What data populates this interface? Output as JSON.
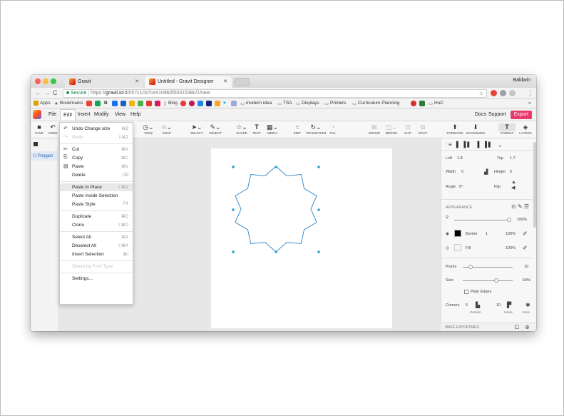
{
  "browser": {
    "tabs": [
      {
        "title": "Gravit"
      },
      {
        "title": "Untitled - Gravit Designer"
      }
    ],
    "profile": "Baldwin",
    "address": {
      "secure_label": "Secure",
      "protocol": "https://",
      "host": "gravit.io",
      "path": "/d/#57c1cb7ce4109b0f0031538c/1/new"
    },
    "bookmarks": [
      "Apps",
      "Bookmarks",
      "Blog",
      "modern idea",
      "TSA",
      "Displays",
      "Printers",
      "Curriculum Planning",
      "HoC"
    ],
    "bookmarks_more": "»"
  },
  "menubar": {
    "items": [
      "File",
      "Edit",
      "Insert",
      "Modify",
      "View",
      "Help"
    ],
    "active": "Edit",
    "docs": "Docs",
    "support": "Support",
    "export": "Export"
  },
  "toolbar": {
    "left": [
      "SAVE",
      "UNDO"
    ],
    "right_of_menu": [
      "VIEW",
      "SNAP",
      "SELECT",
      "OBJECT",
      "SHAPE",
      "TEXT",
      "MEDIA",
      "EDIT",
      "TRANSFORM",
      "FILL",
      "GROUP",
      "MERGE",
      "CLIP",
      "SPLIT",
      "FORWARD",
      "BACKWARD",
      "FORMAT",
      "LAYERS"
    ]
  },
  "layers": {
    "item": "Polygon"
  },
  "edit_menu": [
    {
      "label": "Undo Change size",
      "shortcut": "⌘Z",
      "icon": "undo-icon",
      "disabled": false
    },
    {
      "label": "Redo",
      "shortcut": "⇧⌘Z",
      "icon": "redo-icon",
      "disabled": true
    },
    {
      "sep": true
    },
    {
      "label": "Cut",
      "shortcut": "⌘X",
      "icon": "scissors-icon",
      "disabled": false
    },
    {
      "label": "Copy",
      "shortcut": "⌘C",
      "icon": "copy-icon",
      "disabled": false
    },
    {
      "label": "Paste",
      "shortcut": "⌘V",
      "icon": "paste-icon",
      "disabled": false
    },
    {
      "label": "Delete",
      "shortcut": "⌫",
      "icon": "",
      "disabled": false
    },
    {
      "sep": true
    },
    {
      "label": "Paste In Place",
      "shortcut": "⇧⌘V",
      "icon": "",
      "disabled": false,
      "highlight": true
    },
    {
      "label": "Paste Inside Selection",
      "shortcut": "",
      "icon": "",
      "disabled": false
    },
    {
      "label": "Paste Style",
      "shortcut": "F4",
      "icon": "",
      "disabled": false
    },
    {
      "sep": true
    },
    {
      "label": "Duplicate",
      "shortcut": "⌘D",
      "icon": "",
      "disabled": false
    },
    {
      "label": "Clone",
      "shortcut": "⇧⌘D",
      "icon": "",
      "disabled": false
    },
    {
      "sep": true
    },
    {
      "label": "Select All",
      "shortcut": "⌘A",
      "icon": "",
      "disabled": false
    },
    {
      "label": "Deselect All",
      "shortcut": "⇧⌘A",
      "icon": "",
      "disabled": false
    },
    {
      "label": "Invert Selection",
      "shortcut": "⌘I",
      "icon": "",
      "disabled": false
    },
    {
      "sep": true
    },
    {
      "label": "Select by Font Type",
      "shortcut": "",
      "icon": "",
      "disabled": true
    },
    {
      "sep": true
    },
    {
      "label": "Settings...",
      "shortcut": "",
      "icon": "",
      "disabled": false
    }
  ],
  "inspector": {
    "left_label": "Left",
    "left_value": "1.8",
    "top_label": "Top",
    "top_value": "1.7",
    "width_label": "Width",
    "width_value": "5",
    "height_label": "Height",
    "height_value": "5",
    "angle_label": "Angle",
    "angle_value": "0°",
    "flip_label": "Flip",
    "appearance_title": "APPEARANCE",
    "opacity_value": "100%",
    "border_label": "Border",
    "border_width": "1",
    "border_opacity": "100%",
    "fill_label": "Fill",
    "fill_opacity": "100%",
    "points_label": "Points",
    "points_value": "10",
    "size_label": "Size",
    "size_value": "64%",
    "plain_edges_label": "Plain Edges",
    "corners_label": "Corners",
    "corners_outside_value": "5",
    "corners_inside_value": "10",
    "outside_label": "Outside",
    "inside_label": "Inside",
    "more_label": "More",
    "make_exportable": "MAKE EXPORTABLE"
  },
  "colors": {
    "accent": "#2a9fd6",
    "export": "#ea3a6a",
    "shape_stroke": "#3a8fd0"
  }
}
